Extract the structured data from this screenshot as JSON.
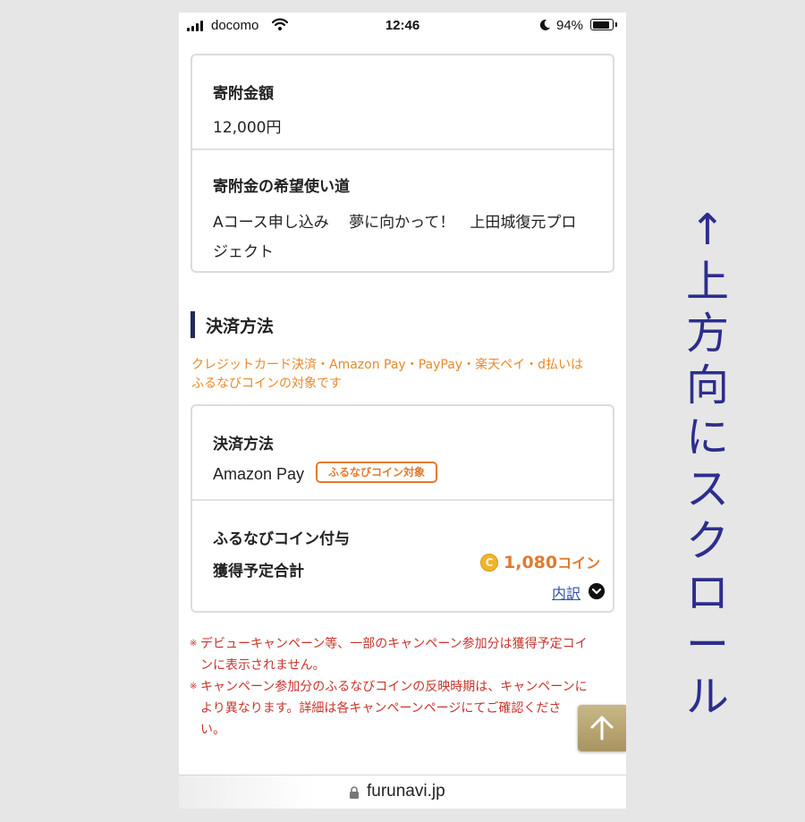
{
  "status_bar": {
    "carrier": "docomo",
    "time": "12:46",
    "battery_percent": "94%",
    "battery_level": 0.94
  },
  "donation_card": {
    "amount_label": "寄附金額",
    "amount_value": "12,000円",
    "usage_label": "寄附金の希望使い道",
    "usage_line1": "Aコース申し込み　 夢に向かって！　上田城復元プロ",
    "usage_line2": "ジェクト"
  },
  "payment_section": {
    "heading": "決済方法",
    "notice_line1": "クレジットカード決済・Amazon Pay・PayPay・楽天ペイ・d払いは",
    "notice_line2": "ふるなびコインの対象です"
  },
  "payment_card": {
    "method_label": "決済方法",
    "method_value": "Amazon Pay",
    "badge": "ふるなびコイン対象",
    "coin_label": "ふるなびコイン付与",
    "scheduled_label": "獲得予定合計",
    "coin_icon_letter": "C",
    "coin_amount": "1,080",
    "coin_unit": "コイン",
    "breakdown_link": "内訳"
  },
  "notes": [
    {
      "mark": "※",
      "line1": "デビューキャンペーン等、一部のキャンペーン参加分は獲得予定コイ",
      "line2": "ンに表示されません。"
    },
    {
      "mark": "※",
      "line1": "キャンペーン参加分のふるなびコインの反映時期は、キャンペーンに",
      "line2": "より異なります。詳細は各キャンペーンページにてご確認くださ",
      "line3": "い。"
    }
  ],
  "address_bar": {
    "url": "furunavi.jp"
  },
  "annotation": {
    "arrow": "↑",
    "chars": [
      "上",
      "方",
      "向",
      "に",
      "ス",
      "ク",
      "ロ",
      "ー",
      "ル"
    ]
  },
  "colors": {
    "accent_orange": "#e07a2e",
    "heading_bar": "#1f2a57",
    "note_red": "#c8342b",
    "link_blue": "#2a4fae",
    "annotation_blue": "#2d2d8f"
  }
}
